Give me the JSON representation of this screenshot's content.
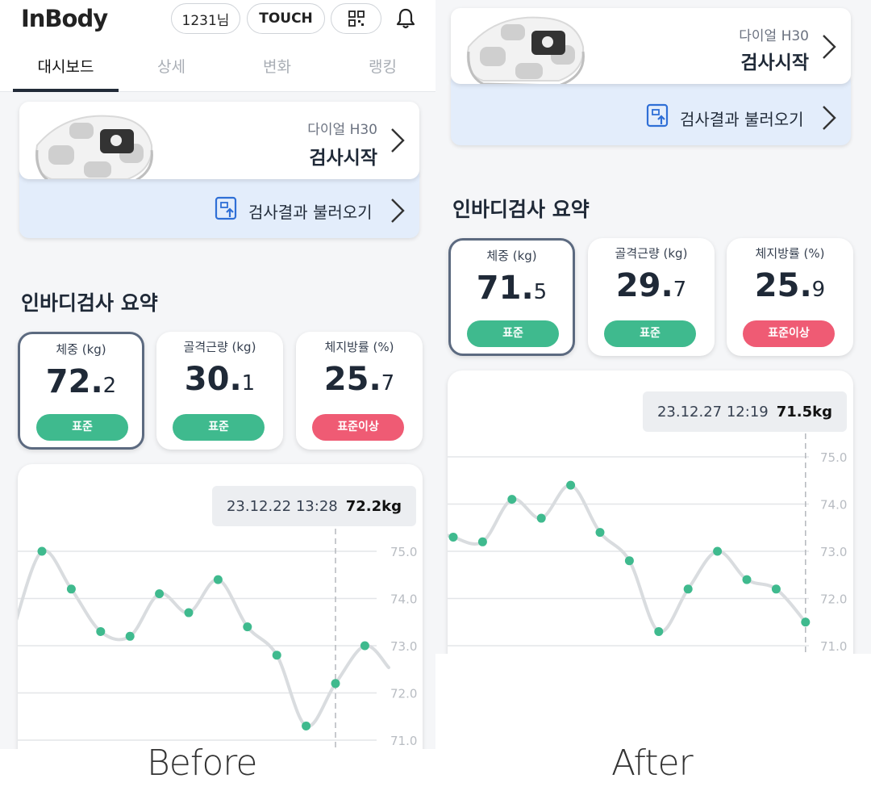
{
  "captions": {
    "before": "Before",
    "after": "After"
  },
  "header": {
    "logo": "InBody",
    "user": "1231님",
    "touch": "TOUCH",
    "tabs": [
      {
        "label": "대시보드",
        "active": true
      },
      {
        "label": "상세",
        "active": false
      },
      {
        "label": "변화",
        "active": false
      },
      {
        "label": "랭킹",
        "active": false
      }
    ]
  },
  "device": {
    "model": "다이얼 H30",
    "start": "검사시작"
  },
  "import_label": "검사결과 불러오기",
  "summary_title": "인바디검사 요약",
  "colors": {
    "green": "#3fba8e",
    "red": "#ef5b74",
    "accent_border": "#5c6a80",
    "import_bg": "#e3edfb"
  },
  "before": {
    "metrics": [
      {
        "label": "체중 (kg)",
        "int": "72.",
        "dec": "2",
        "badge": "표준",
        "status": "green"
      },
      {
        "label": "골격근량 (kg)",
        "int": "30.",
        "dec": "1",
        "badge": "표준",
        "status": "green"
      },
      {
        "label": "체지방률 (%)",
        "int": "25.",
        "dec": "7",
        "badge": "표준이상",
        "status": "red"
      }
    ],
    "tooltip": {
      "datetime": "23.12.22 13:28",
      "weight": "72.2kg"
    }
  },
  "after": {
    "metrics": [
      {
        "label": "체중 (kg)",
        "int": "71.",
        "dec": "5",
        "badge": "표준",
        "status": "green"
      },
      {
        "label": "골격근량 (kg)",
        "int": "29.",
        "dec": "7",
        "badge": "표준",
        "status": "green"
      },
      {
        "label": "체지방률 (%)",
        "int": "25.",
        "dec": "9",
        "badge": "표준이상",
        "status": "red"
      }
    ],
    "tooltip": {
      "datetime": "23.12.27 12:19",
      "weight": "71.5kg"
    }
  },
  "chart_data": [
    {
      "type": "line",
      "title": "",
      "ylim": [
        71.0,
        75.0
      ],
      "yticks": [
        "75.0",
        "74.0",
        "73.0",
        "72.0",
        "71.0"
      ],
      "values": [
        75.0,
        74.2,
        73.3,
        73.2,
        74.1,
        73.7,
        74.4,
        73.4,
        72.8,
        71.3,
        72.2,
        73.0
      ],
      "selected_index": 10,
      "grid": true
    },
    {
      "type": "line",
      "title": "",
      "ylim": [
        71.0,
        75.0
      ],
      "yticks": [
        "75.0",
        "74.0",
        "73.0",
        "72.0",
        "71.0"
      ],
      "values": [
        73.3,
        73.2,
        74.1,
        73.7,
        74.4,
        73.4,
        72.8,
        71.3,
        72.2,
        73.0,
        72.4,
        72.2,
        71.5
      ],
      "selected_index": 12,
      "grid": true
    }
  ]
}
